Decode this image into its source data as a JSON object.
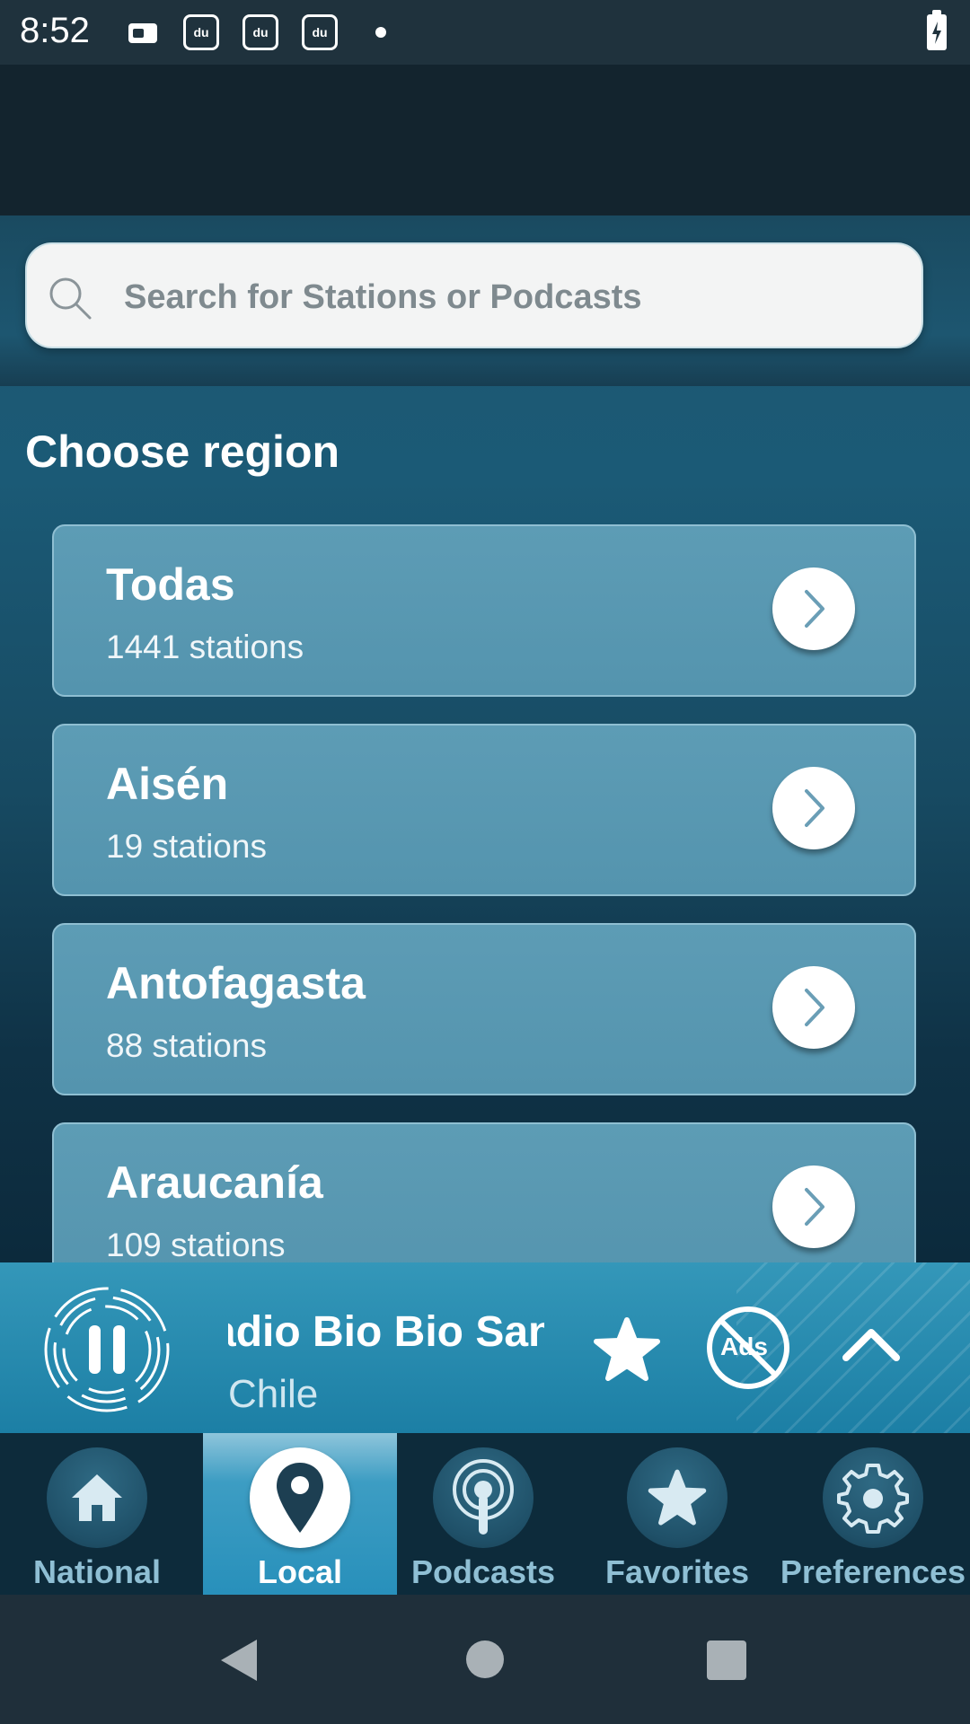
{
  "status_bar": {
    "time": "8:52",
    "notif_icon_text": "du"
  },
  "search": {
    "placeholder": "Search for Stations or Podcasts"
  },
  "section": {
    "title": "Choose region"
  },
  "regions": [
    {
      "name": "Todas",
      "count": "1441 stations"
    },
    {
      "name": "Aisén",
      "count": "19 stations"
    },
    {
      "name": "Antofagasta",
      "count": "88 stations"
    },
    {
      "name": "Araucanía",
      "count": "109 stations"
    }
  ],
  "player": {
    "station_visible": "adio Bio Bio San",
    "country": "Chile",
    "noads_label": "Ads"
  },
  "nav": [
    {
      "label": "National",
      "icon": "home-icon",
      "active": false
    },
    {
      "label": "Local",
      "icon": "location-pin-icon",
      "active": true
    },
    {
      "label": "Podcasts",
      "icon": "podcast-icon",
      "active": false
    },
    {
      "label": "Favorites",
      "icon": "star-icon",
      "active": false
    },
    {
      "label": "Preferences",
      "icon": "gear-icon",
      "active": false
    }
  ],
  "colors": {
    "accent": "#2890bb",
    "card": "#5a98b2",
    "nav_bg": "#0d2b3b"
  }
}
